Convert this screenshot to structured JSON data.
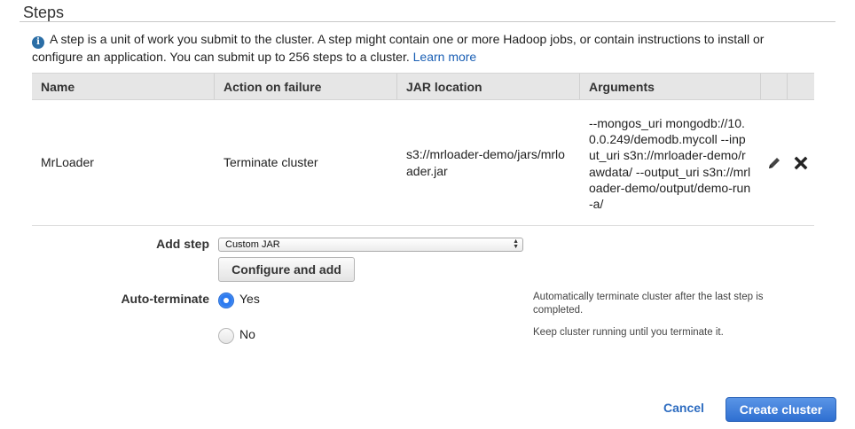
{
  "section": {
    "title": "Steps"
  },
  "info": {
    "text": "A step is a unit of work you submit to the cluster. A step might contain one or more Hadoop jobs, or contain instructions to install or configure an application. You can submit up to 256 steps to a cluster.",
    "learn_more": "Learn more"
  },
  "table": {
    "headers": {
      "name": "Name",
      "action": "Action on failure",
      "jar": "JAR location",
      "args": "Arguments"
    },
    "rows": [
      {
        "name": "MrLoader",
        "action": "Terminate cluster",
        "jar": "s3://mrloader-demo/jars/mrloader.jar",
        "args": "--mongos_uri mongodb://10.0.0.249/demodb.mycoll --input_uri s3n://mrloader-demo/rawdata/ --output_uri s3n://mrloader-demo/output/demo-run-a/"
      }
    ]
  },
  "add_step": {
    "label": "Add step",
    "selected": "Custom JAR",
    "configure_button": "Configure and add"
  },
  "auto_terminate": {
    "label": "Auto-terminate",
    "options": [
      {
        "label": "Yes",
        "selected": true,
        "help": "Automatically terminate cluster after the last step is completed."
      },
      {
        "label": "No",
        "selected": false,
        "help": "Keep cluster running until you terminate it."
      }
    ]
  },
  "footer": {
    "cancel": "Cancel",
    "create": "Create cluster"
  },
  "colors": {
    "link": "#1a5fb4",
    "primary_button": "#2f6fd1",
    "radio_selected": "#2d7bf0"
  },
  "icons": {
    "info": "info-icon",
    "edit": "pencil-icon",
    "delete": "close-icon",
    "select": "chevron-updown-icon"
  }
}
